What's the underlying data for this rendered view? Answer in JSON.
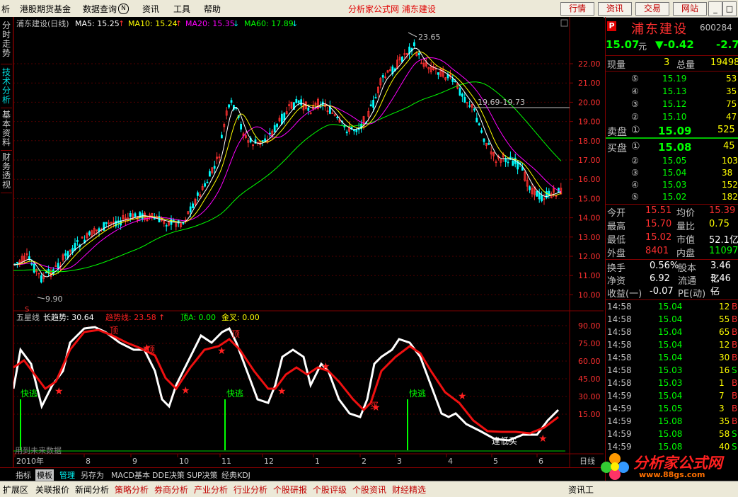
{
  "menu": {
    "items": [
      "析",
      "港股期货基金",
      "数据查询",
      "资讯",
      "工具",
      "帮助"
    ],
    "search_icon_label": "N",
    "center_title": "分析家公式网  浦东建设",
    "buttons": [
      "行情",
      "资讯",
      "交易",
      "网站"
    ],
    "window_buttons": [
      "_",
      "□",
      "×"
    ]
  },
  "left_tabs": [
    "分时走势",
    "技术分析",
    "基本资料",
    "财务透视"
  ],
  "main_chart": {
    "title": "浦东建设(日线)",
    "ma_labels": [
      {
        "text": "MA5: 15.25",
        "color": "#ffffff"
      },
      {
        "text": "MA10: 15.24",
        "color": "#ffff00"
      },
      {
        "text": "MA20: 15.35",
        "color": "#ff00ff"
      },
      {
        "text": "MA60: 17.89",
        "color": "#00ff00"
      }
    ],
    "y_ticks": [
      "22.00",
      "21.00",
      "20.00",
      "19.00",
      "18.00",
      "17.00",
      "16.00",
      "15.00",
      "14.00",
      "13.00",
      "12.00",
      "11.00",
      "10.00"
    ],
    "high_label": "23.65",
    "low_label": "9.90",
    "range_label": "19.69-19.73",
    "s_marker": "S"
  },
  "indicator": {
    "labels": [
      {
        "text": "五星线",
        "color": "#c0c0c0"
      },
      {
        "text": "长趋势: 30.64",
        "color": "#ffffff"
      },
      {
        "text": "趋势线: 23.58",
        "color": "#ff2020"
      },
      {
        "text": "顶A: 0.00",
        "color": "#00ff00"
      },
      {
        "text": "金叉: 0.00",
        "color": "#ffff00"
      }
    ],
    "y_ticks": [
      "90.00",
      "75.00",
      "60.00",
      "45.00",
      "30.00",
      "15.00"
    ],
    "annotations": [
      "快逃",
      "快逃",
      "快逃",
      "顶",
      "顶",
      "顶",
      "买",
      "逢低买"
    ],
    "note": "用到未来数据"
  },
  "x_axis": {
    "labels": [
      "2010年",
      "8",
      "9",
      "10",
      "11",
      "12",
      "1",
      "2",
      "3",
      "4",
      "5",
      "6"
    ],
    "period": "日线"
  },
  "bottom_tabs": [
    "指标",
    "模板",
    "管理",
    "另存为",
    "MACD基本",
    "DDE决策",
    "SUP决策",
    "经典KDJ"
  ],
  "bottom_links": [
    "扩展区",
    "关联报价",
    "新闻分析",
    "策略分析",
    "券商分析",
    "产业分析",
    "行业分析",
    "个股研报",
    "个股评级",
    "个股资讯",
    "财经精选"
  ],
  "bottom_right": "资讯工",
  "stock": {
    "logo": "P",
    "name": "浦东建设",
    "code": "600284",
    "price": "15.07",
    "unit": "元",
    "change": "▼-0.42",
    "pct": "-2.7",
    "vol_label": "现量",
    "vol": "3",
    "total_label": "总量",
    "total": "19498",
    "sell": [
      {
        "idx": "⑤",
        "price": "15.19",
        "vol": "53"
      },
      {
        "idx": "④",
        "price": "15.13",
        "vol": "35"
      },
      {
        "idx": "③",
        "price": "15.12",
        "vol": "75"
      },
      {
        "idx": "②",
        "price": "15.10",
        "vol": "47"
      }
    ],
    "sell1": {
      "label": "卖盘",
      "idx": "①",
      "price": "15.09",
      "vol": "525"
    },
    "buy1": {
      "label": "买盘",
      "idx": "①",
      "price": "15.08",
      "vol": "45"
    },
    "buy": [
      {
        "idx": "②",
        "price": "15.05",
        "vol": "103"
      },
      {
        "idx": "③",
        "price": "15.04",
        "vol": "38"
      },
      {
        "idx": "④",
        "price": "15.03",
        "vol": "152"
      },
      {
        "idx": "⑤",
        "price": "15.02",
        "vol": "182"
      }
    ],
    "stats": [
      {
        "k1": "今开",
        "v1": "15.51",
        "c1": "#ff3030",
        "k2": "均价",
        "v2": "15.39",
        "c2": "#ff3030"
      },
      {
        "k1": "最高",
        "v1": "15.70",
        "c1": "#ff3030",
        "k2": "量比",
        "v2": "0.75",
        "c2": "#ffff00"
      },
      {
        "k1": "最低",
        "v1": "15.02",
        "c1": "#ff3030",
        "k2": "市值",
        "v2": "52.1亿",
        "c2": "#ffffff"
      },
      {
        "k1": "外盘",
        "v1": "8401",
        "c1": "#ff3030",
        "k2": "内盘",
        "v2": "11097",
        "c2": "#00ff00"
      }
    ],
    "stats2": [
      {
        "k1": "换手",
        "v1": "0.56%",
        "k2": "股本",
        "v2": "3.46亿"
      },
      {
        "k1": "净资",
        "v1": "6.92",
        "k2": "流通",
        "v2": "3.46亿"
      },
      {
        "k1": "收益(一)",
        "v1": "-0.07",
        "k2": "PE(动)",
        "v2": "—"
      }
    ],
    "ticks": [
      {
        "time": "14:58",
        "price": "15.04",
        "vol": "12",
        "flag": "B"
      },
      {
        "time": "14:58",
        "price": "15.04",
        "vol": "55",
        "flag": "B"
      },
      {
        "time": "14:58",
        "price": "15.04",
        "vol": "65",
        "flag": "B"
      },
      {
        "time": "14:58",
        "price": "15.04",
        "vol": "12",
        "flag": "B"
      },
      {
        "time": "14:58",
        "price": "15.04",
        "vol": "30",
        "flag": "B"
      },
      {
        "time": "14:58",
        "price": "15.03",
        "vol": "16",
        "flag": "S"
      },
      {
        "time": "14:58",
        "price": "15.03",
        "vol": "1",
        "flag": "B"
      },
      {
        "time": "14:59",
        "price": "15.04",
        "vol": "7",
        "flag": "B"
      },
      {
        "time": "14:59",
        "price": "15.05",
        "vol": "3",
        "flag": "B"
      },
      {
        "time": "14:59",
        "price": "15.08",
        "vol": "35",
        "flag": "B"
      },
      {
        "time": "14:59",
        "price": "15.08",
        "vol": "58",
        "flag": "S"
      },
      {
        "time": "14:59",
        "price": "15.08",
        "vol": "40",
        "flag": "S"
      }
    ]
  },
  "watermark": {
    "text": "分析家公式网",
    "url": "www.88gs.com"
  },
  "colors": {
    "grid": "#800000",
    "up": "#ff3030",
    "down": "#00ffff",
    "ma5": "#ffffff",
    "ma10": "#ffff00",
    "ma20": "#ff00ff",
    "ma60": "#00ff00"
  }
}
